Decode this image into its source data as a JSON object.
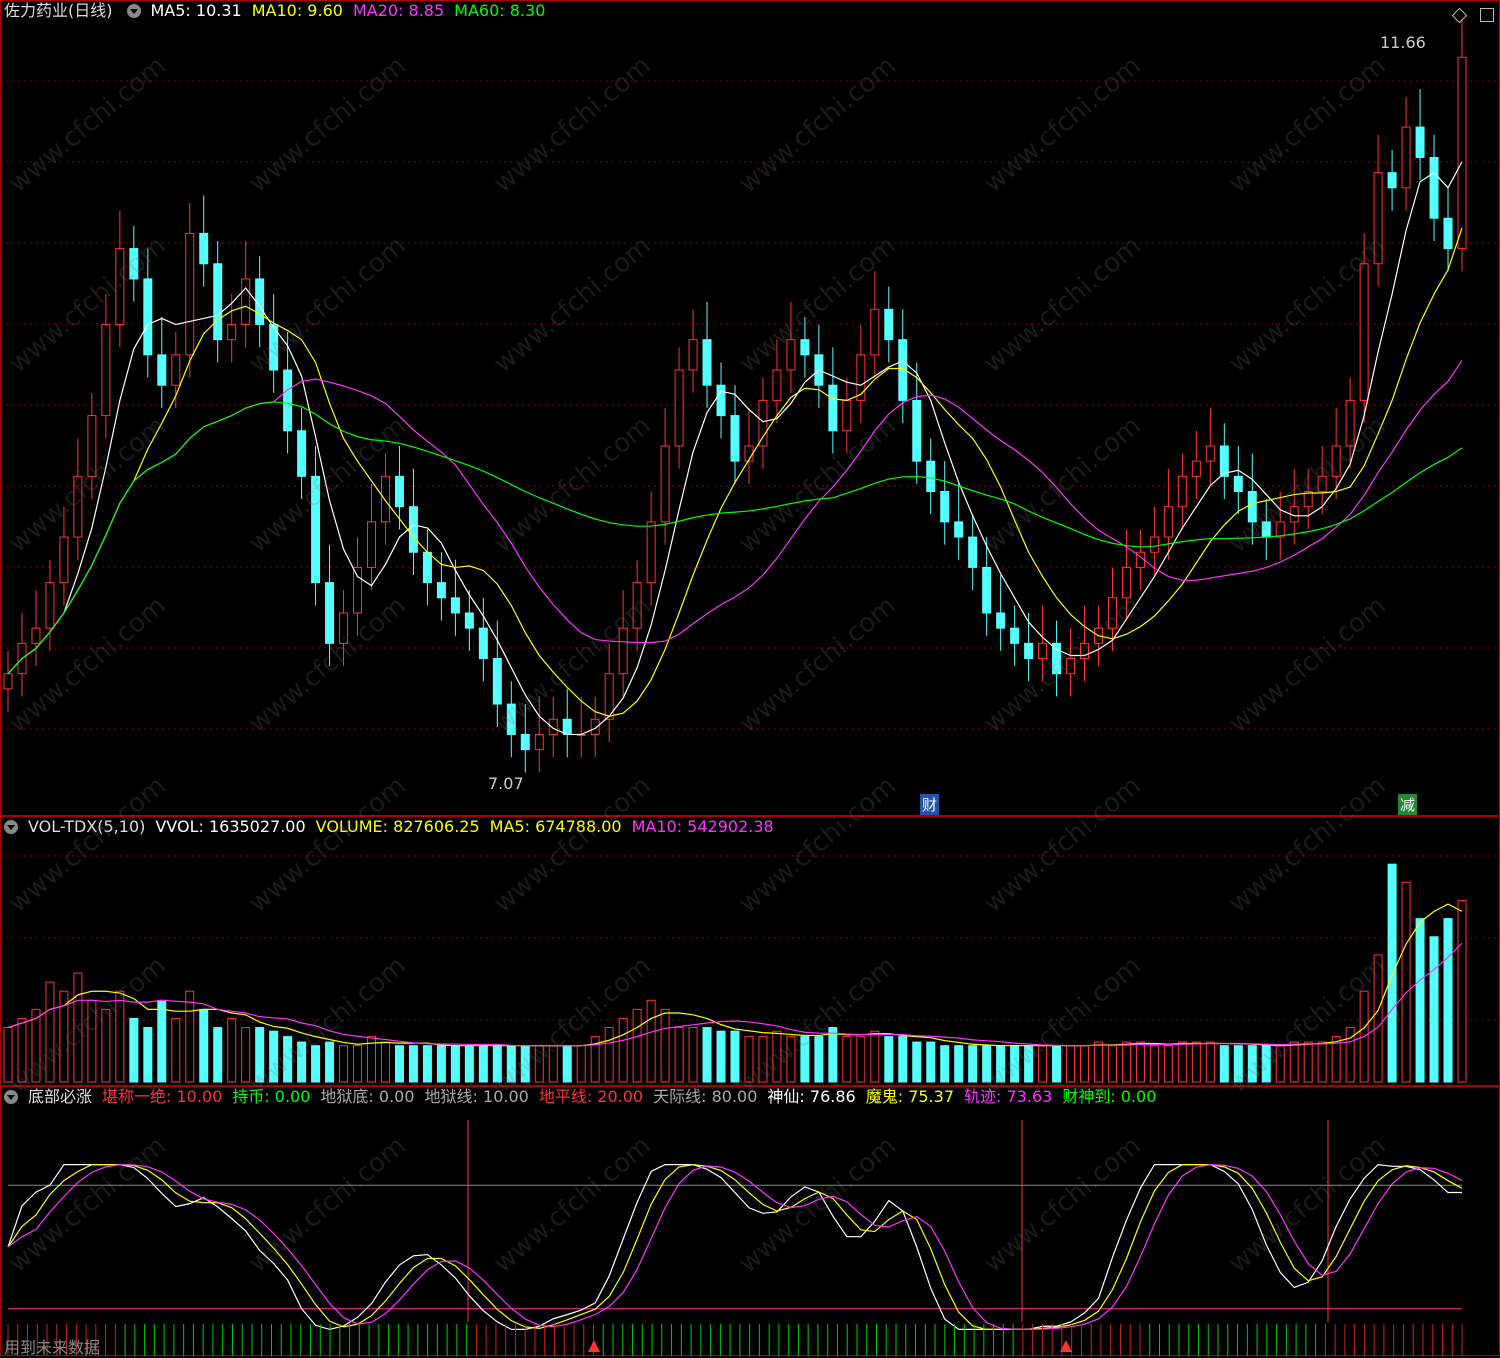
{
  "price_panel": {
    "stock_name": "佐力药业(日线)",
    "ma_labels": [
      {
        "text": "MA5: 10.31",
        "color": "#ffffff"
      },
      {
        "text": "MA10: 9.60",
        "color": "#ffff00"
      },
      {
        "text": "MA20: 8.85",
        "color": "#ff33ff"
      },
      {
        "text": "MA60: 8.30",
        "color": "#00ff00"
      }
    ],
    "high_label": "11.66",
    "low_label": "7.07",
    "marker_cai": "财",
    "marker_jian": "减"
  },
  "volume_panel": {
    "labels": [
      {
        "text": "VOL-TDX(5,10)",
        "color": "#dddddd"
      },
      {
        "text": "VVOL: 1635027.00",
        "color": "#ffffff"
      },
      {
        "text": "VOLUME: 827606.25",
        "color": "#ffff00"
      },
      {
        "text": "MA5: 674788.00",
        "color": "#ffff00"
      },
      {
        "text": "MA10: 542902.38",
        "color": "#ff33ff"
      }
    ]
  },
  "indicator_panel": {
    "labels": [
      {
        "text": "底部必涨",
        "color": "#dddddd"
      },
      {
        "text": "堪称一绝: 10.00",
        "color": "#ff3333"
      },
      {
        "text": "持币: 0.00",
        "color": "#00ff00"
      },
      {
        "text": "地狱底: 0.00",
        "color": "#aaaaaa"
      },
      {
        "text": "地狱线: 10.00",
        "color": "#aaaaaa"
      },
      {
        "text": "地平线: 20.00",
        "color": "#ff3333"
      },
      {
        "text": "天际线: 80.00",
        "color": "#aaaaaa"
      },
      {
        "text": "神仙: 76.86",
        "color": "#ffffff"
      },
      {
        "text": "魔鬼: 75.37",
        "color": "#ffff00"
      },
      {
        "text": "轨迹: 73.63",
        "color": "#ff33ff"
      },
      {
        "text": "财神到: 0.00",
        "color": "#00ff00"
      }
    ],
    "footer": "用到未来数据"
  },
  "watermark": "www.cfchi.com",
  "chart_data": {
    "type": "candlestick",
    "closes": [
      7.6,
      7.8,
      7.9,
      8.2,
      8.5,
      8.9,
      9.3,
      9.9,
      10.4,
      10.2,
      9.7,
      9.5,
      9.7,
      10.5,
      10.3,
      9.8,
      9.9,
      10.2,
      9.9,
      9.6,
      9.2,
      8.9,
      8.2,
      7.8,
      8.0,
      8.3,
      8.6,
      8.9,
      8.7,
      8.4,
      8.2,
      8.1,
      8.0,
      7.9,
      7.7,
      7.4,
      7.2,
      7.1,
      7.2,
      7.3,
      7.2,
      7.2,
      7.3,
      7.6,
      7.9,
      8.2,
      8.6,
      9.1,
      9.6,
      9.8,
      9.5,
      9.3,
      9.0,
      9.1,
      9.4,
      9.6,
      9.8,
      9.7,
      9.5,
      9.2,
      9.4,
      9.7,
      10.0,
      9.8,
      9.4,
      9.0,
      8.8,
      8.6,
      8.5,
      8.3,
      8.0,
      7.9,
      7.8,
      7.7,
      7.8,
      7.6,
      7.7,
      7.8,
      7.9,
      8.1,
      8.3,
      8.4,
      8.5,
      8.7,
      8.9,
      9.0,
      9.1,
      8.9,
      8.8,
      8.6,
      8.5,
      8.6,
      8.7,
      8.8,
      8.9,
      9.1,
      9.4,
      10.3,
      10.9,
      10.8,
      11.2,
      11.0,
      10.6,
      10.4,
      11.66
    ],
    "ma5_last": 10.31,
    "ma10_last": 9.6,
    "ma20_last": 8.85,
    "ma60_last": 8.3,
    "high": 11.66,
    "low": 7.07,
    "volume": [
      0.3,
      0.35,
      0.4,
      0.55,
      0.5,
      0.6,
      0.45,
      0.4,
      0.5,
      0.35,
      0.3,
      0.45,
      0.35,
      0.5,
      0.4,
      0.3,
      0.35,
      0.3,
      0.3,
      0.28,
      0.25,
      0.22,
      0.2,
      0.22,
      0.2,
      0.2,
      0.25,
      0.22,
      0.2,
      0.2,
      0.2,
      0.2,
      0.2,
      0.2,
      0.2,
      0.2,
      0.2,
      0.2,
      0.2,
      0.2,
      0.2,
      0.2,
      0.25,
      0.3,
      0.35,
      0.4,
      0.45,
      0.4,
      0.3,
      0.3,
      0.3,
      0.28,
      0.28,
      0.25,
      0.25,
      0.28,
      0.25,
      0.25,
      0.25,
      0.3,
      0.25,
      0.25,
      0.28,
      0.25,
      0.25,
      0.22,
      0.22,
      0.2,
      0.2,
      0.2,
      0.2,
      0.2,
      0.2,
      0.2,
      0.2,
      0.2,
      0.2,
      0.2,
      0.22,
      0.2,
      0.22,
      0.22,
      0.2,
      0.2,
      0.22,
      0.22,
      0.22,
      0.2,
      0.2,
      0.2,
      0.2,
      0.2,
      0.22,
      0.22,
      0.22,
      0.25,
      0.3,
      0.5,
      0.7,
      1.2,
      1.1,
      0.9,
      0.8,
      0.9,
      1.0
    ],
    "indicator": {
      "shenxian_last": 76.86,
      "mogui_last": 75.37,
      "guiji_last": 73.63,
      "diping": 20.0,
      "tianji": 80.0
    }
  }
}
